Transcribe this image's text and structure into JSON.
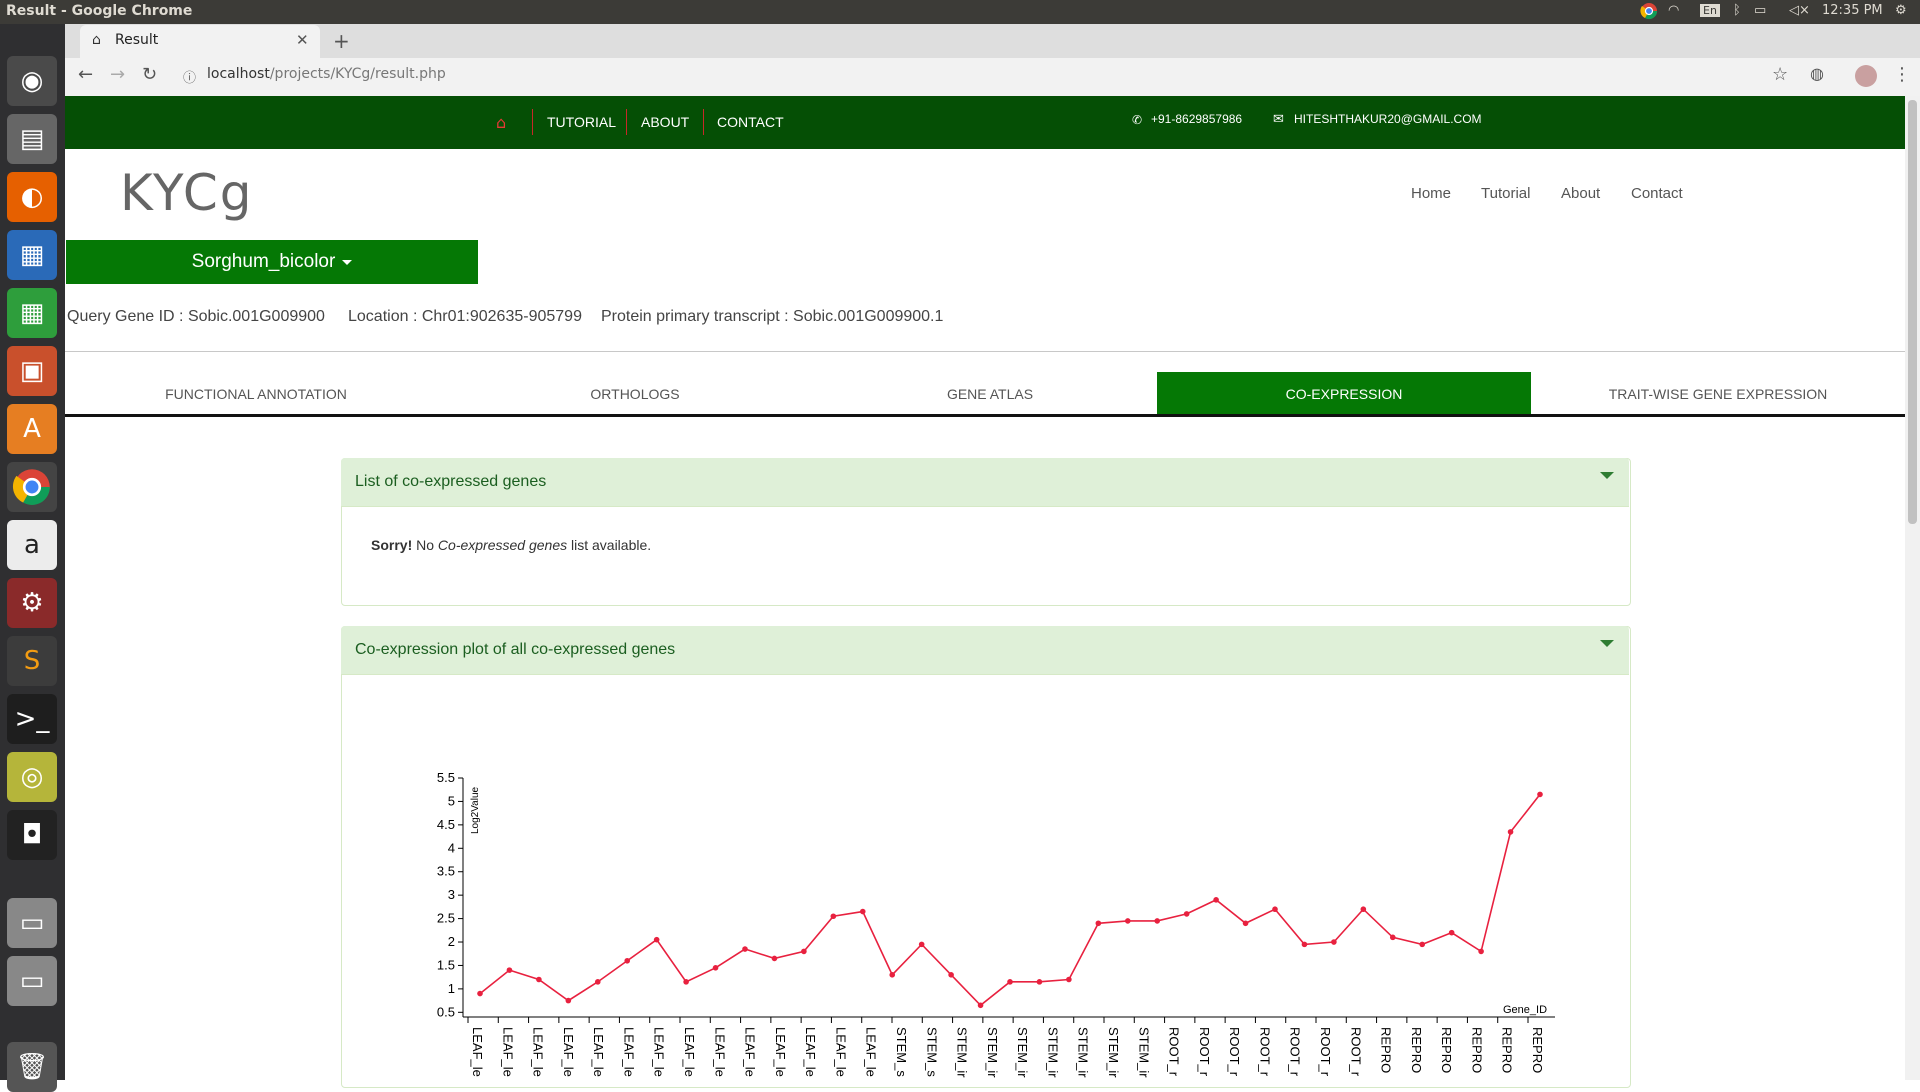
{
  "os": {
    "window_title": "Result - Google Chrome",
    "lang": "En",
    "time": "12:35 PM"
  },
  "browser": {
    "tab_title": "Result",
    "url_host": "localhost",
    "url_path": "/projects/KYCg/result.php"
  },
  "topnav": {
    "items": [
      "TUTORIAL",
      "ABOUT",
      "CONTACT"
    ],
    "phone": "+91-8629857986",
    "email": "HITESHTHAKUR20@GMAIL.COM"
  },
  "site": {
    "logo": "KYCg",
    "nav": [
      "Home",
      "Tutorial",
      "About",
      "Contact"
    ],
    "species": "Sorghum_bicolor"
  },
  "query": {
    "gene_id": "Query Gene ID : Sobic.001G009900",
    "location": "Location : Chr01:902635-905799",
    "transcript": "Protein primary transcript : Sobic.001G009900.1"
  },
  "tabs": [
    "FUNCTIONAL ANNOTATION",
    "ORTHOLOGS",
    "GENE ATLAS",
    "CO-EXPRESSION",
    "TRAIT-WISE GENE EXPRESSION"
  ],
  "active_tab": "CO-EXPRESSION",
  "panels": {
    "list_title": "List of co-expressed genes",
    "sorry_bold": "Sorry!",
    "sorry_pre": " No ",
    "sorry_italic": "Co-expressed genes",
    "sorry_post": " list available.",
    "plot_title": "Co-expression plot of all co-expressed genes"
  },
  "colors": {
    "dark_green": "#054f05",
    "button_green": "#057805",
    "panel_bg": "#dff0d8",
    "line": "#e8213f"
  },
  "chart_data": {
    "type": "line",
    "ylabel": "Log2Value",
    "xlabel": "Gene_ID",
    "ylim": [
      0.4,
      5.5
    ],
    "yticks": [
      0.5,
      1,
      1.5,
      2,
      2.5,
      3,
      3.5,
      4,
      4.5,
      5,
      5.5
    ],
    "categories": [
      "LEAF_le",
      "LEAF_le",
      "LEAF_le",
      "LEAF_le",
      "LEAF_le",
      "LEAF_le",
      "LEAF_le",
      "LEAF_le",
      "LEAF_le",
      "LEAF_le",
      "LEAF_le",
      "LEAF_le",
      "LEAF_le",
      "LEAF_le",
      "STEM_s",
      "STEM_s",
      "STEM_ir",
      "STEM_ir",
      "STEM_ir",
      "STEM_ir",
      "STEM_ir",
      "STEM_ir",
      "STEM_ir",
      "ROOT_r",
      "ROOT_r",
      "ROOT_r",
      "ROOT_r",
      "ROOT_r",
      "ROOT_r",
      "ROOT_r",
      "REPRO",
      "REPRO",
      "REPRO",
      "REPRO",
      "REPRO",
      "REPRO"
    ],
    "series": [
      {
        "values": [
          0.9,
          1.4,
          1.2,
          0.75,
          1.15,
          1.6,
          2.05,
          1.15,
          1.45,
          1.85,
          1.65,
          1.8,
          2.55,
          2.65,
          1.3,
          1.95,
          1.3,
          0.65,
          1.15,
          1.15,
          1.2,
          2.4,
          2.45,
          2.45,
          2.6,
          2.9,
          2.4,
          2.7,
          1.95,
          2.0,
          2.7,
          2.1,
          1.95,
          2.2,
          1.8,
          4.35,
          5.15
        ]
      }
    ]
  }
}
